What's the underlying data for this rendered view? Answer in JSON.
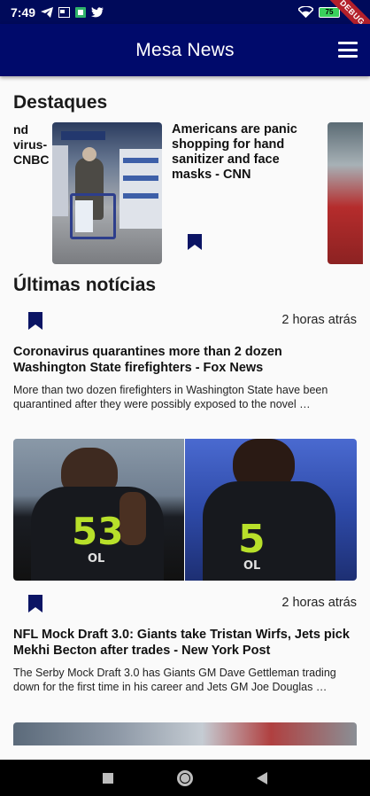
{
  "status": {
    "time": "7:49",
    "battery": "75",
    "debug_banner": "DEBUG"
  },
  "app_bar": {
    "title": "Mesa News",
    "menu_icon": "hamburger-menu-icon"
  },
  "highlights": {
    "section_title": "Destaques",
    "items": [
      {
        "title_fragment": "nd\nvirus-\nCNBC"
      },
      {
        "title": "Americans are panic shopping for hand sanitizer and face masks - CNN",
        "bookmark_icon": "bookmark-icon"
      },
      {
        "title": ""
      }
    ]
  },
  "latest": {
    "section_title": "Últimas notícias",
    "items": [
      {
        "time": "2 horas atrás",
        "title": "Coronavirus quarantines more than 2 dozen Washington State firefighters - Fox News",
        "description": "More than two dozen firefighters in Washington State have been quarantined after they were possibly exposed to the novel …"
      },
      {
        "time": "2 horas atrás",
        "title": "NFL Mock Draft 3.0: Giants take Tristan Wirfs, Jets pick Mekhi Becton after trades - New York Post",
        "description": "The Serby Mock Draft 3.0 has Giants GM Dave Gettleman trading down for the first time in his career and Jets GM Joe Douglas …",
        "image_jersey_left": "53",
        "image_jersey_right": "5",
        "image_tag": "OL"
      }
    ]
  },
  "colors": {
    "app_bar": "#000a6b",
    "bookmark": "#0b1464",
    "background": "#fafafa"
  }
}
